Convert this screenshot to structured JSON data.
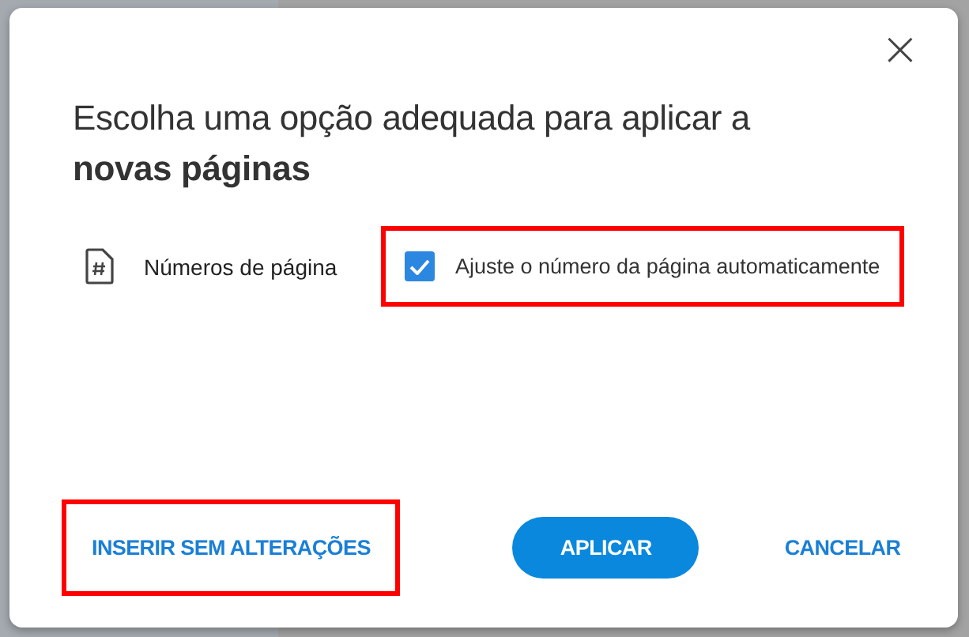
{
  "dialog": {
    "close": "×",
    "title": "Escolha uma opção adequada para aplicar a\n**novas páginas**",
    "options": [
      {
        "label": "Números de página",
        "choice": "Ajuste o número da página automaticamente",
        "checked": true,
        "highlighted": true
      }
    ],
    "buttons": [
      {
        "label": "INSERIR SEM ALTERAÇÕES",
        "kind": "text",
        "highlighted": true
      },
      {
        "label": "APLICAR",
        "kind": "primary",
        "highlighted": false
      },
      {
        "label": "CANCELAR",
        "kind": "text",
        "highlighted": false
      }
    ]
  }
}
